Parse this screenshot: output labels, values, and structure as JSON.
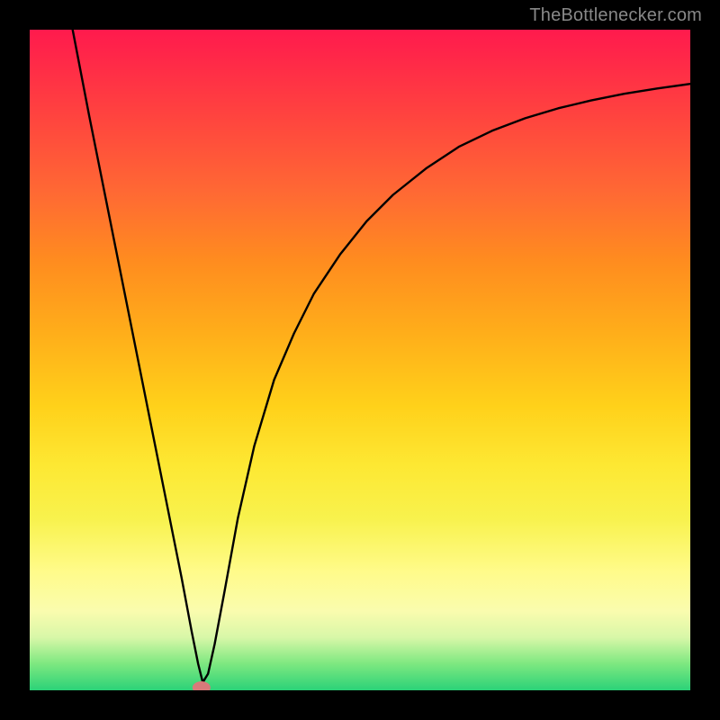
{
  "watermark": "TheBottlenecker.com",
  "chart_data": {
    "type": "line",
    "title": "",
    "xlabel": "",
    "ylabel": "",
    "xrange": [
      0,
      100
    ],
    "yrange": [
      0,
      100
    ],
    "series": [
      {
        "name": "curve",
        "x": [
          6.5,
          9,
          12,
          15,
          18,
          21,
          23,
          24.5,
          25.5,
          26.2,
          27,
          28,
          29.5,
          31.5,
          34,
          37,
          40,
          43,
          47,
          51,
          55,
          60,
          65,
          70,
          75,
          80,
          85,
          90,
          95,
          100
        ],
        "y": [
          100,
          87,
          72,
          57,
          42,
          27,
          17,
          9,
          4,
          1.2,
          2.5,
          7,
          15,
          26,
          37,
          47,
          54,
          60,
          66,
          71,
          75,
          79,
          82.3,
          84.7,
          86.6,
          88.1,
          89.3,
          90.3,
          91.1,
          91.8
        ]
      }
    ],
    "marker": {
      "x": 26.0,
      "y": 0.4,
      "color": "#d87a7a",
      "rx": 10,
      "ry": 7
    },
    "colors": {
      "curve_stroke": "#000000",
      "background_frame": "#000000",
      "gradient_stops": [
        "#ff1a4d",
        "#ff4040",
        "#ff6a33",
        "#ff8c1f",
        "#ffae1a",
        "#ffd11a",
        "#fde833",
        "#f8f24d",
        "#fffb8a",
        "#fafcae",
        "#d8f7a8",
        "#7de880",
        "#2bd278"
      ],
      "marker_fill": "#d87a7a"
    }
  }
}
